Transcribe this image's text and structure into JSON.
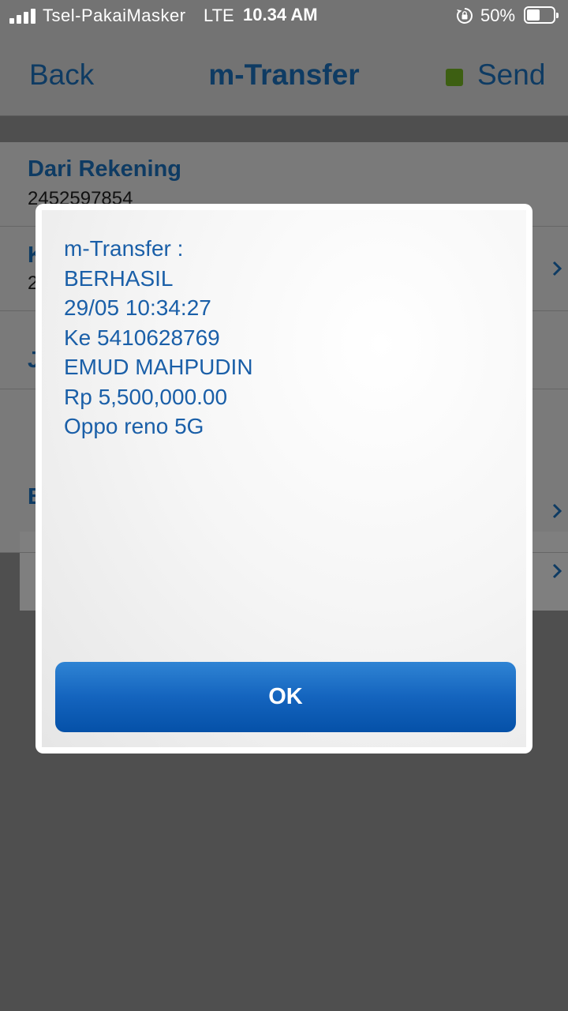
{
  "status_bar": {
    "carrier": "Tsel-PakaiMasker",
    "network": "LTE",
    "time": "10.34 AM",
    "battery_percent": "50%",
    "icons": [
      "signal-icon",
      "rotation-lock-icon",
      "battery-icon"
    ]
  },
  "nav": {
    "back_label": "Back",
    "title": "m-Transfer",
    "send_label": "Send",
    "send_status_color": "#3d5f12"
  },
  "form": {
    "rows": [
      {
        "label": "Dari Rekening",
        "value": "2452597854"
      },
      {
        "label": "K",
        "value": "2"
      },
      {
        "label": "J",
        "value": ""
      },
      {
        "label": "",
        "value": ""
      },
      {
        "label": "B",
        "value": ""
      }
    ]
  },
  "dialog": {
    "lines": [
      "m-Transfer :",
      "BERHASIL",
      "29/05 10:34:27",
      "Ke 5410628769",
      "EMUD MAHPUDIN",
      "Rp 5,500,000.00",
      "Oppo reno 5G"
    ],
    "ok_label": "OK"
  },
  "colors": {
    "accent": "#0e3b63",
    "dialog_text": "#1a5fa8",
    "button": "#1464be",
    "overlay": "#4f4f4f"
  }
}
